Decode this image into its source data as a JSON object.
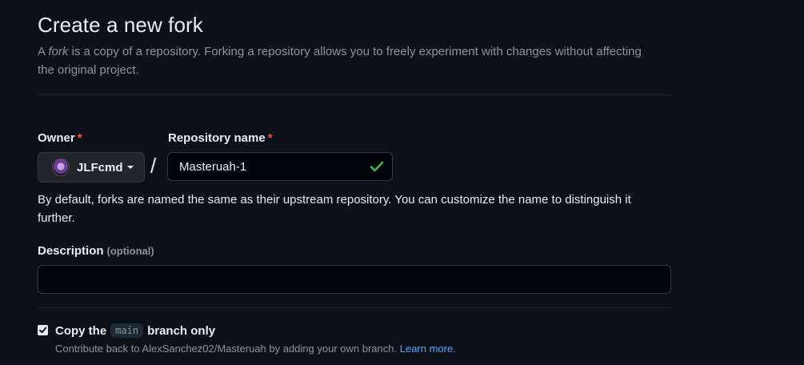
{
  "page": {
    "title": "Create a new fork",
    "intro_prefix": "A ",
    "intro_em": "fork",
    "intro_rest": " is a copy of a repository. Forking a repository allows you to freely experiment with changes without affecting the original project."
  },
  "form": {
    "owner_label": "Owner",
    "required_mark": "*",
    "owner_value": "JLFcmd",
    "separator": "/",
    "repo_label": "Repository name",
    "repo_value": "Masteruah-1",
    "repo_valid": true,
    "repo_help": "By default, forks are named the same as their upstream repository. You can customize the name to distinguish it further.",
    "description_label": "Description",
    "description_optional": "(optional)",
    "description_value": "",
    "copy_branch": {
      "checked": true,
      "prefix": "Copy the",
      "branch": "main",
      "suffix": "branch only",
      "note": "Contribute back to AlexSanchez02/Masteruah by adding your own branch.",
      "link": "Learn more."
    }
  },
  "colors": {
    "background": "#0d1117",
    "accent_link": "#58a6ff",
    "required": "#f85149",
    "success": "#3fb950"
  },
  "icons": {
    "owner_caret": "caret-down-icon",
    "repo_valid": "check-icon",
    "checkbox": "checkbox-checked-icon"
  }
}
